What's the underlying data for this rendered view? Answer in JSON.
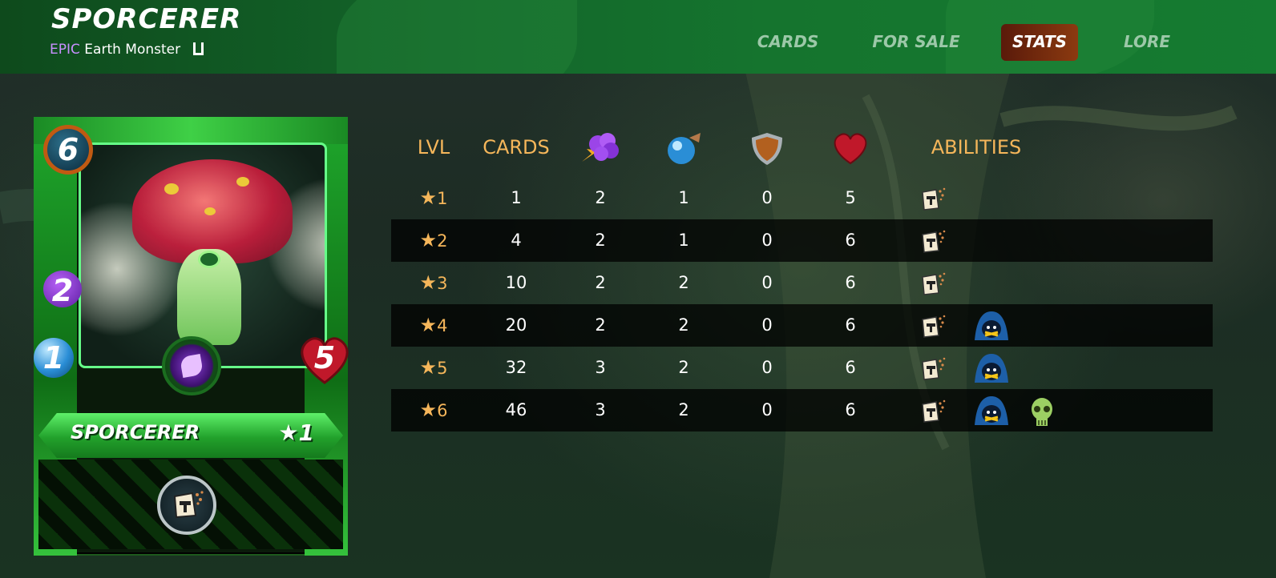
{
  "header": {
    "title": "SPORCERER",
    "rarity": "EPIC",
    "type_text": "Earth Monster",
    "edition_icon": "untamed-edition-icon"
  },
  "nav": {
    "items": [
      {
        "label": "CARDS",
        "active": false
      },
      {
        "label": "FOR SALE",
        "active": false
      },
      {
        "label": "STATS",
        "active": true
      },
      {
        "label": "LORE",
        "active": false
      }
    ]
  },
  "card": {
    "name": "SPORCERER",
    "level": "★1",
    "mana": "6",
    "magic": "2",
    "speed": "1",
    "health": "5",
    "element_icon": "earth-leaf-icon",
    "ability_icon": "affliction-icon"
  },
  "table": {
    "headers": {
      "lvl": "LVL",
      "cards": "CARDS",
      "magic_icon": "magic-attack-icon",
      "speed_icon": "speed-icon",
      "armor_icon": "armor-shield-icon",
      "health_icon": "health-heart-icon",
      "abilities": "ABILITIES"
    },
    "rows": [
      {
        "lvl": "1",
        "cards": "1",
        "magic": "2",
        "speed": "1",
        "armor": "0",
        "health": "5",
        "abilities": [
          "affliction-icon"
        ]
      },
      {
        "lvl": "2",
        "cards": "4",
        "magic": "2",
        "speed": "1",
        "armor": "0",
        "health": "6",
        "abilities": [
          "affliction-icon"
        ]
      },
      {
        "lvl": "3",
        "cards": "10",
        "magic": "2",
        "speed": "2",
        "armor": "0",
        "health": "6",
        "abilities": [
          "affliction-icon"
        ]
      },
      {
        "lvl": "4",
        "cards": "20",
        "magic": "2",
        "speed": "2",
        "armor": "0",
        "health": "6",
        "abilities": [
          "affliction-icon",
          "silence-icon"
        ]
      },
      {
        "lvl": "5",
        "cards": "32",
        "magic": "3",
        "speed": "2",
        "armor": "0",
        "health": "6",
        "abilities": [
          "affliction-icon",
          "silence-icon"
        ]
      },
      {
        "lvl": "6",
        "cards": "46",
        "magic": "3",
        "speed": "2",
        "armor": "0",
        "health": "6",
        "abilities": [
          "affliction-icon",
          "silence-icon",
          "poison-skull-icon"
        ]
      }
    ]
  },
  "colors": {
    "header_green": "#157b31",
    "accent_gold": "#f5b65a",
    "rarity_purple": "#c890ff",
    "active_tab": "#8b3a10"
  }
}
